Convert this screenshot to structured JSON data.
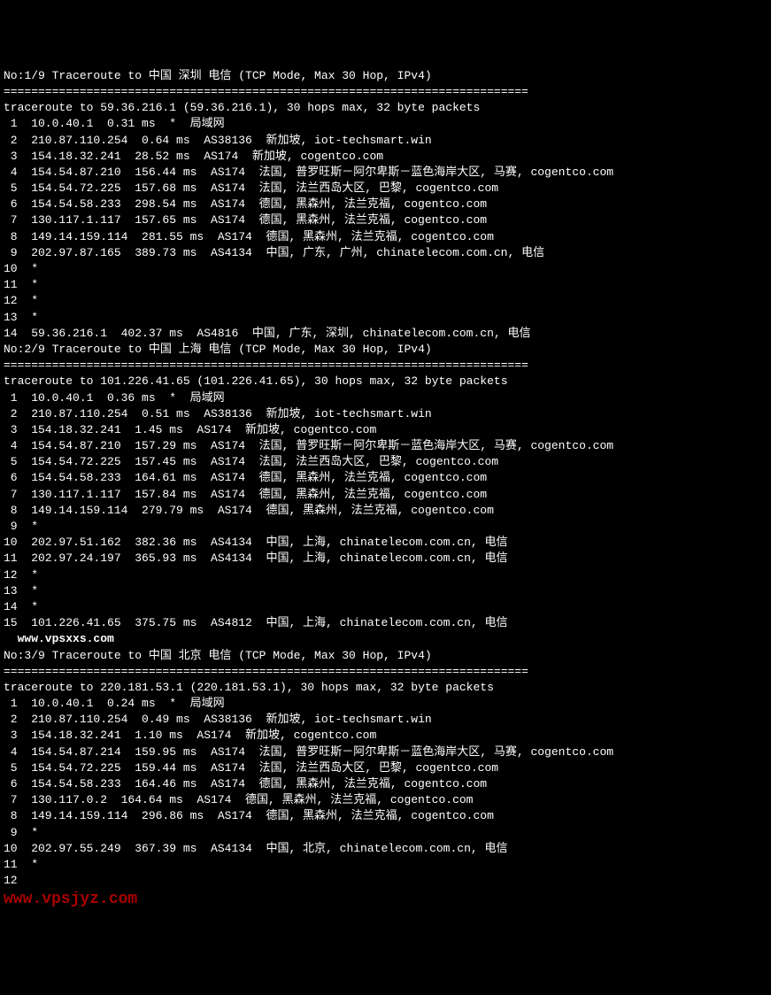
{
  "traces": [
    {
      "header": "No:1/9 Traceroute to 中国 深圳 电信 (TCP Mode, Max 30 Hop, IPv4)",
      "separator": "============================================================================",
      "info": "traceroute to 59.36.216.1 (59.36.216.1), 30 hops max, 32 byte packets",
      "hops": [
        " 1  10.0.40.1  0.31 ms  *  局域网",
        " 2  210.87.110.254  0.64 ms  AS38136  新加坡, iot-techsmart.win",
        " 3  154.18.32.241  28.52 ms  AS174  新加坡, cogentco.com",
        " 4  154.54.87.210  156.44 ms  AS174  法国, 普罗旺斯－阿尔卑斯－蓝色海岸大区, 马赛, cogentco.com",
        " 5  154.54.72.225  157.68 ms  AS174  法国, 法兰西岛大区, 巴黎, cogentco.com",
        " 6  154.54.58.233  298.54 ms  AS174  德国, 黑森州, 法兰克福, cogentco.com",
        " 7  130.117.1.117  157.65 ms  AS174  德国, 黑森州, 法兰克福, cogentco.com",
        " 8  149.14.159.114  281.55 ms  AS174  德国, 黑森州, 法兰克福, cogentco.com",
        " 9  202.97.87.165  389.73 ms  AS4134  中国, 广东, 广州, chinatelecom.com.cn, 电信",
        "10  *",
        "11  *",
        "12  *",
        "13  *",
        "14  59.36.216.1  402.37 ms  AS4816  中国, 广东, 深圳, chinatelecom.com.cn, 电信"
      ]
    },
    {
      "header": "No:2/9 Traceroute to 中国 上海 电信 (TCP Mode, Max 30 Hop, IPv4)",
      "separator": "============================================================================",
      "info": "traceroute to 101.226.41.65 (101.226.41.65), 30 hops max, 32 byte packets",
      "hops": [
        " 1  10.0.40.1  0.36 ms  *  局域网",
        " 2  210.87.110.254  0.51 ms  AS38136  新加坡, iot-techsmart.win",
        " 3  154.18.32.241  1.45 ms  AS174  新加坡, cogentco.com",
        " 4  154.54.87.210  157.29 ms  AS174  法国, 普罗旺斯－阿尔卑斯－蓝色海岸大区, 马赛, cogentco.com",
        " 5  154.54.72.225  157.45 ms  AS174  法国, 法兰西岛大区, 巴黎, cogentco.com",
        " 6  154.54.58.233  164.61 ms  AS174  德国, 黑森州, 法兰克福, cogentco.com",
        " 7  130.117.1.117  157.84 ms  AS174  德国, 黑森州, 法兰克福, cogentco.com",
        " 8  149.14.159.114  279.79 ms  AS174  德国, 黑森州, 法兰克福, cogentco.com",
        " 9  *",
        "10  202.97.51.162  382.36 ms  AS4134  中国, 上海, chinatelecom.com.cn, 电信",
        "11  202.97.24.197  365.93 ms  AS4134  中国, 上海, chinatelecom.com.cn, 电信",
        "12  *",
        "13  *",
        "14  *",
        "15  101.226.41.65  375.75 ms  AS4812  中国, 上海, chinatelecom.com.cn, 电信"
      ]
    },
    {
      "header": "No:3/9 Traceroute to 中国 北京 电信 (TCP Mode, Max 30 Hop, IPv4)",
      "separator": "============================================================================",
      "info": "traceroute to 220.181.53.1 (220.181.53.1), 30 hops max, 32 byte packets",
      "hops": [
        " 1  10.0.40.1  0.24 ms  *  局域网",
        " 2  210.87.110.254  0.49 ms  AS38136  新加坡, iot-techsmart.win",
        " 3  154.18.32.241  1.10 ms  AS174  新加坡, cogentco.com",
        " 4  154.54.87.214  159.95 ms  AS174  法国, 普罗旺斯－阿尔卑斯－蓝色海岸大区, 马赛, cogentco.com",
        " 5  154.54.72.225  159.44 ms  AS174  法国, 法兰西岛大区, 巴黎, cogentco.com",
        " 6  154.54.58.233  164.46 ms  AS174  德国, 黑森州, 法兰克福, cogentco.com",
        " 7  130.117.0.2  164.64 ms  AS174  德国, 黑森州, 法兰克福, cogentco.com",
        " 8  149.14.159.114  296.86 ms  AS174  德国, 黑森州, 法兰克福, cogentco.com",
        " 9  *",
        "10  202.97.55.249  367.39 ms  AS4134  中国, 北京, chinatelecom.com.cn, 电信",
        "11  *",
        "12"
      ]
    }
  ],
  "watermark1": "www.vpsxxs.com",
  "watermark2": "www.vpsjyz.com"
}
